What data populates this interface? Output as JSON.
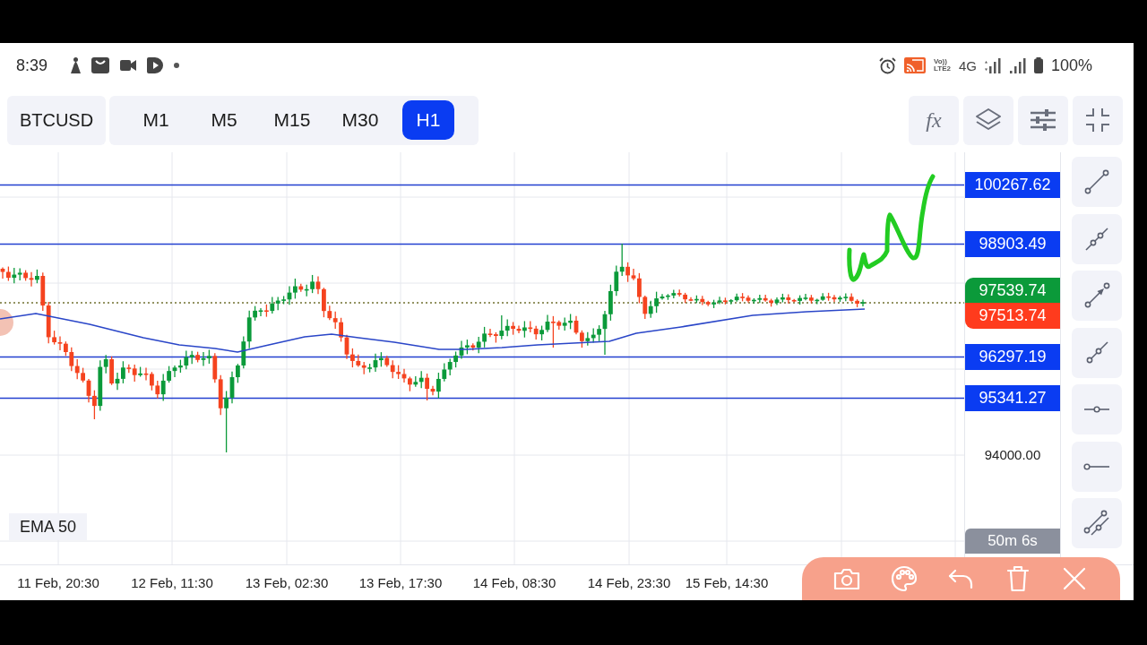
{
  "status_bar": {
    "time": "8:39",
    "volte_top": "Vo))",
    "volte_bottom": "LTE2",
    "network": "4G",
    "battery": "100%"
  },
  "toolbar": {
    "symbol": "BTCUSD",
    "timeframes": [
      {
        "label": "M1",
        "selected": false
      },
      {
        "label": "M5",
        "selected": false
      },
      {
        "label": "M15",
        "selected": false
      },
      {
        "label": "M30",
        "selected": false
      },
      {
        "label": "H1",
        "selected": true
      }
    ],
    "indicator_button": "fx"
  },
  "chart": {
    "indicator": "EMA 50",
    "price_lines": [
      "100267.62",
      "98903.49",
      "96297.19",
      "95341.27"
    ],
    "quotes": [
      {
        "kind": "ask",
        "price": "97539.74"
      },
      {
        "kind": "bid",
        "price": "97513.74"
      }
    ],
    "price_axis": [
      "94000.00"
    ],
    "countdown": "50m 6s",
    "time_axis": [
      "11 Feb, 20:30",
      "12 Feb, 11:30",
      "13 Feb, 02:30",
      "13 Feb, 17:30",
      "14 Feb, 08:30",
      "14 Feb, 23:30",
      "15 Feb, 14:30"
    ]
  }
}
